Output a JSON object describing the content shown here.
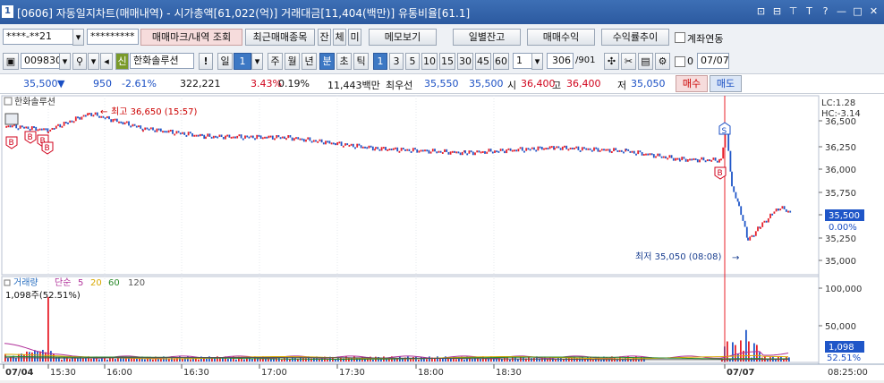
{
  "window": {
    "number": "1",
    "title": "[0606] 자동일지차트(매매내역) - 시가총액[61,022(억)] 거래대금[11,404(백만)] 유통비율[61.1]",
    "controls": [
      "⊡",
      "⊟",
      "⊤",
      "T",
      "?",
      "—",
      "□",
      "✕"
    ]
  },
  "toolbar1": {
    "account": "****-**21",
    "password": "*********",
    "btn_trade_mark": "매매마크/내역 조회",
    "btn_recent": "최근매매종목",
    "btn_jan": "잔",
    "btn_che": "체",
    "btn_mi": "미",
    "btn_memo": "메모보기",
    "btn_daily_balance": "일별잔고",
    "btn_trade_profit": "매매수익",
    "btn_profit_trend": "수익률추이",
    "chk_account_link": "계좌연동"
  },
  "toolbar2": {
    "code": "009830",
    "stock_name": "한화솔루션",
    "badge_sin": "신",
    "btn_warn": "!",
    "period_daily": "일",
    "period_num": "1",
    "periods": [
      "주",
      "월",
      "년",
      "분",
      "초",
      "틱"
    ],
    "selected_period": "분",
    "minutes": [
      "1",
      "3",
      "5",
      "10",
      "15",
      "30",
      "45",
      "60"
    ],
    "selected_minute": "1",
    "count_value": "1",
    "count_display": "306",
    "count_total": "/901",
    "date_checkbox_label": "0",
    "date": "07/07"
  },
  "quote": {
    "price": "35,500",
    "change": "950",
    "change_pct": "-2.61%",
    "volume": "322,221",
    "vol_ratio": "3.43%",
    "turnover": "0.19%",
    "amount": "11,443백만",
    "priority_label": "최우선",
    "ask": "35,550",
    "bid": "35,500",
    "open_label": "시",
    "open": "36,400",
    "high_label": "고",
    "high": "36,400",
    "low_label": "저",
    "low": "35,050",
    "btn_buy": "매수",
    "btn_sell": "매도"
  },
  "price_panel": {
    "legend": "한화솔루션",
    "lc": "LC:1.28",
    "hc": "HC:-3.14",
    "high_annotation": "최고 36,650 (15:57)",
    "low_annotation": "최저 35,050 (08:08)",
    "y_ticks": [
      "36,500",
      "36,250",
      "36,000",
      "35,750",
      "35,500",
      "35,250",
      "35,000"
    ],
    "current_price_tag": "35,500",
    "current_pct_tag": "0.00%",
    "markers": {
      "buy": "B",
      "sell": "S"
    }
  },
  "volume_panel": {
    "legend_title": "거래량",
    "legend_ma": "단순",
    "ma_periods": [
      "5",
      "20",
      "60",
      "120"
    ],
    "ma_colors": [
      "#b0309a",
      "#d8a800",
      "#2a8a2a",
      "#555555"
    ],
    "current_label": "1,098주(52.51%)",
    "y_ticks": [
      "100,000",
      "50,000"
    ],
    "current_tag": "1,098",
    "current_pct_tag": "52.51%"
  },
  "x_axis": {
    "ticks": [
      "07/04",
      "15:30",
      "16:00",
      "16:30",
      "17:00",
      "17:30",
      "18:00",
      "18:30",
      "07/07"
    ],
    "right_time": "08:25:00"
  },
  "colors": {
    "up": "#e8202a",
    "down": "#1f56c8",
    "title_bar": "#2c5aa0"
  }
}
